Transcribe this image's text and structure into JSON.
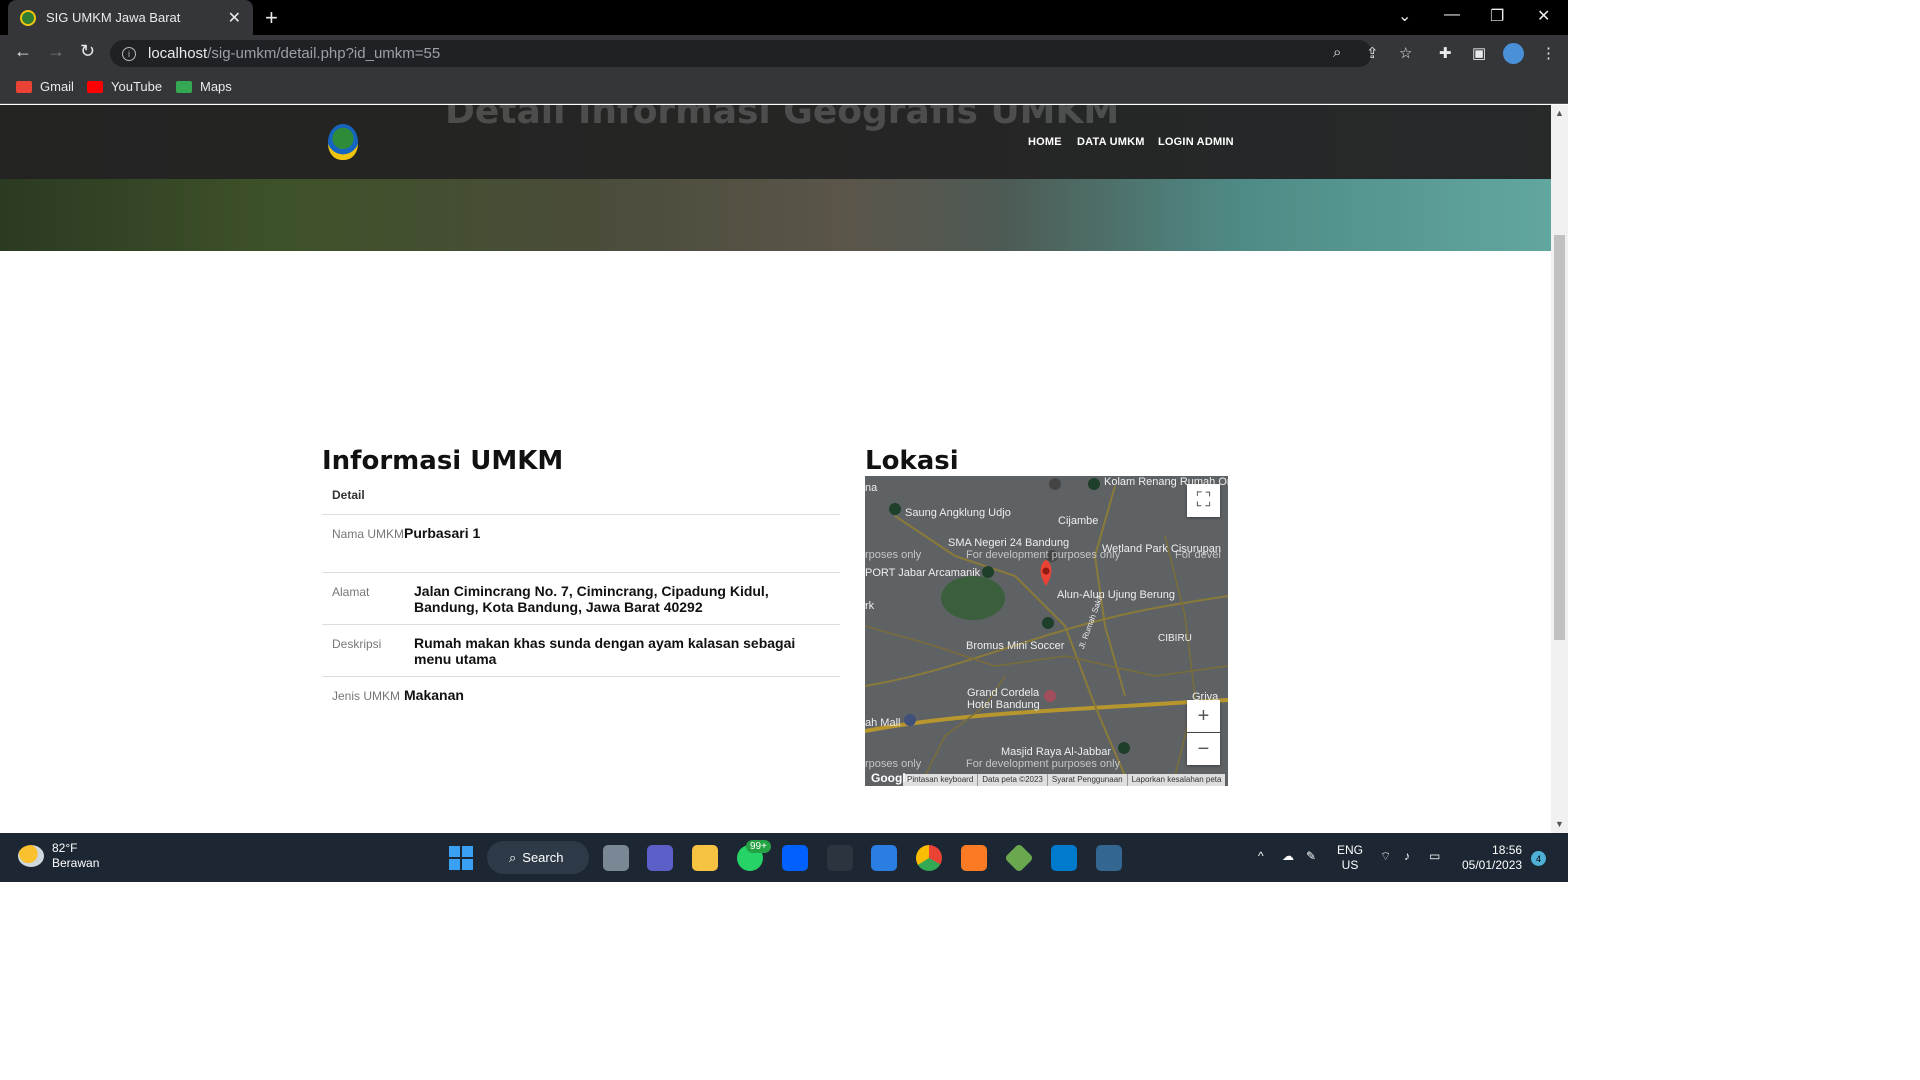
{
  "browser": {
    "tab_title": "SIG UMKM Jawa Barat",
    "new_tab": "+",
    "tab_close": "✕",
    "url_host": "localhost",
    "url_path": "/sig-umkm/detail.php?id_umkm=55",
    "bookmarks": [
      {
        "label": "Gmail",
        "icon": "gmail-icon",
        "color": "#ea4335"
      },
      {
        "label": "YouTube",
        "icon": "youtube-icon",
        "color": "#ff0000"
      },
      {
        "label": "Maps",
        "icon": "maps-icon",
        "color": "#34a853"
      }
    ]
  },
  "site": {
    "hero_title": "Detail Informasi Geografis UMKM",
    "nav": [
      "HOME",
      "DATA UMKM",
      "LOGIN ADMIN"
    ]
  },
  "info": {
    "heading": "Informasi UMKM",
    "table_header": "Detail",
    "rows": [
      {
        "label": "Nama UMKM",
        "value": "Purbasari 1"
      },
      {
        "label": "Alamat",
        "value": "Jalan Cimincrang No. 7, Cimincrang, Cipadung Kidul, Bandung, Kota Bandung, Jawa Barat 40292"
      },
      {
        "label": "Deskripsi",
        "value": "Rumah makan khas sunda dengan ayam kalasan sebagai menu utama"
      },
      {
        "label": "Jenis UMKM",
        "value": "Makanan"
      }
    ]
  },
  "location": {
    "heading": "Lokasi",
    "map_labels": {
      "kolam": "Kolam Renang Rumah Oma Opa",
      "saung": "Saung Angklung Udjo",
      "cijambe": "Cijambe",
      "sma": "SMA Negeri 24 Bandung",
      "wetland": "Wetland Park Cisurupan",
      "sport": "PORT Jabar Arcamanik",
      "alun": "Alun-Alun Ujung Berung",
      "cibiru": "CIBIRU",
      "bromus": "Bromus Mini Soccer",
      "grand": "Grand Cordela Hotel Bandung",
      "masjid": "Masjid Raya Al-Jabbar",
      "mall": "ah Mall",
      "jl": "Jl. Rumah Sakit",
      "dev1": "For development purposes only",
      "dev_left": "rposes only",
      "dev_right": "For devel",
      "griya": "Griya",
      "rk": "rk",
      "na": "na"
    },
    "attribution": [
      "Pintasan keyboard",
      "Data peta ©2023",
      "Syarat Penggunaan",
      "Laporkan kesalahan peta"
    ],
    "google": "Google",
    "zoom_in": "+",
    "zoom_out": "−",
    "fullscreen": "⛶"
  },
  "taskbar": {
    "temp": "82°F",
    "weather": "Berawan",
    "search": "Search",
    "whatsapp_badge": "99+",
    "lang1": "ENG",
    "lang2": "US",
    "time": "18:56",
    "date": "05/01/2023",
    "notifications": "4"
  }
}
